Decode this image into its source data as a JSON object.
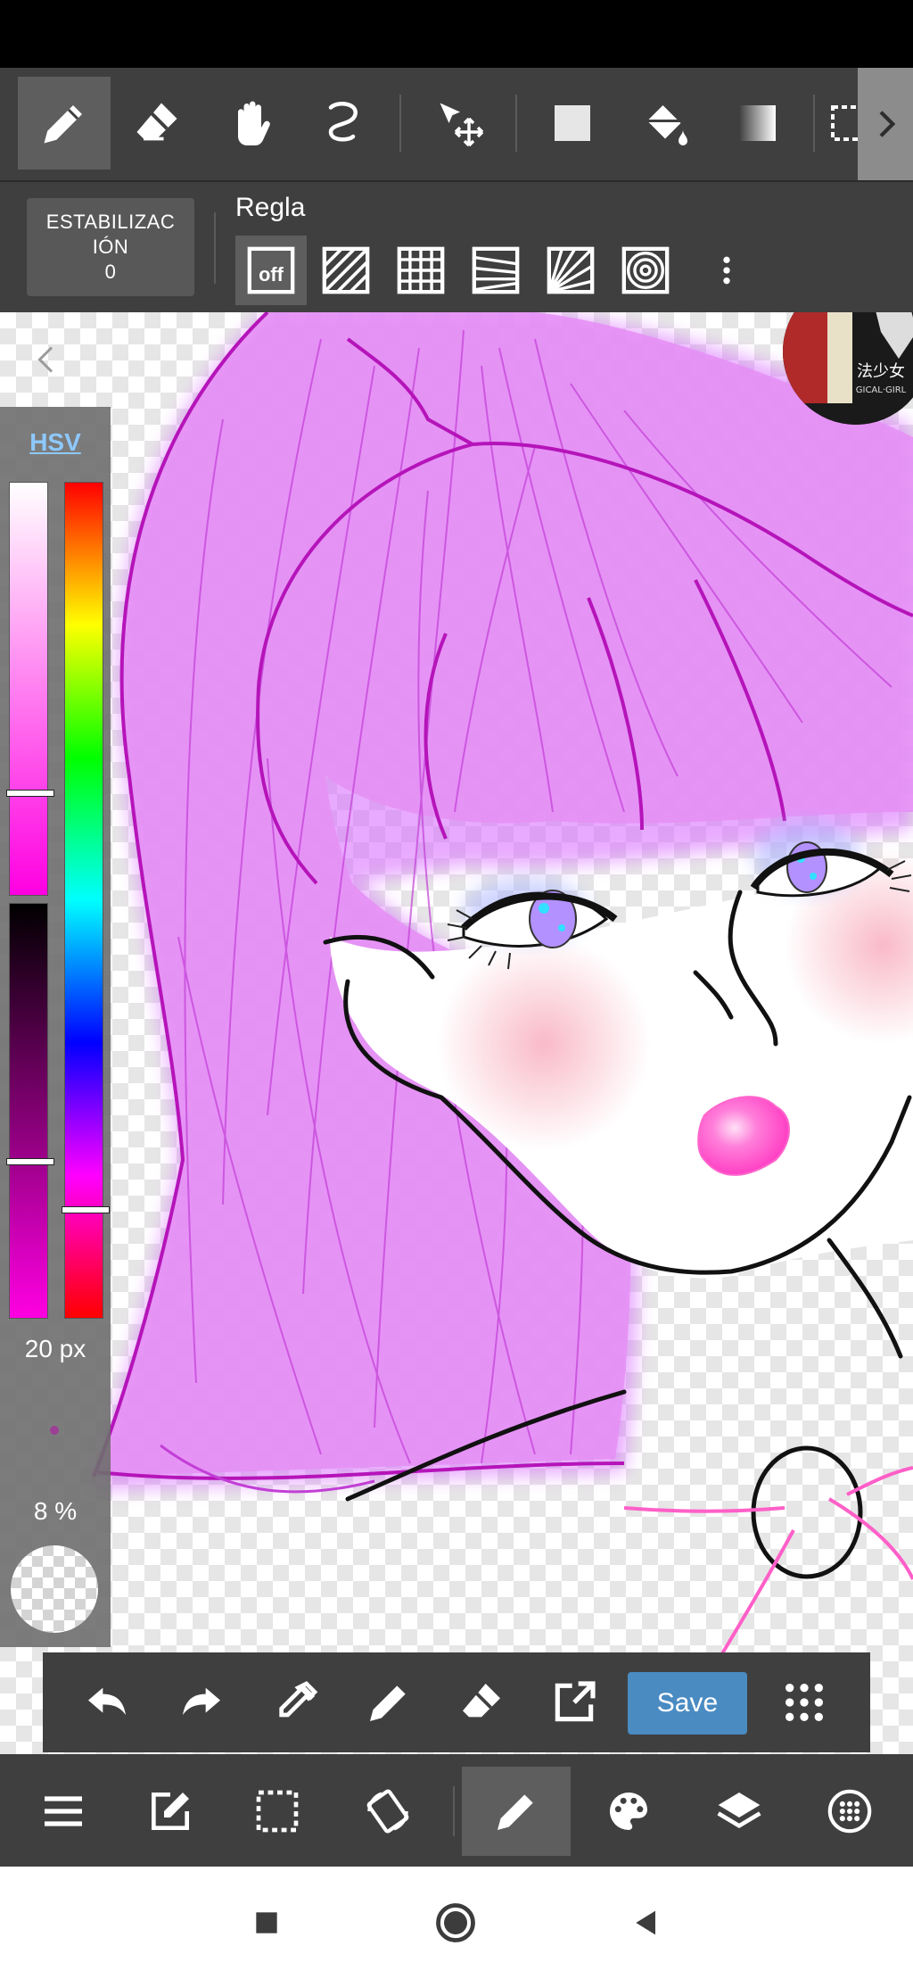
{
  "top_toolbar": {
    "tools": [
      {
        "icon": "pen-icon",
        "active": true
      },
      {
        "icon": "eraser-icon",
        "active": false
      },
      {
        "icon": "hand-icon",
        "active": false
      },
      {
        "icon": "lasso-icon",
        "active": false
      },
      {
        "icon": "move-icon",
        "active": false
      },
      {
        "icon": "fill-rect-icon",
        "active": false
      },
      {
        "icon": "bucket-icon",
        "active": false
      },
      {
        "icon": "gradient-icon",
        "active": false
      },
      {
        "icon": "select-icon",
        "active": false
      }
    ]
  },
  "sub_toolbar": {
    "stabilization_label": "ESTABILIZAC IÓN",
    "stabilization_line1": "ESTABILIZAC",
    "stabilization_line2": "IÓN",
    "stabilization_value": "0",
    "ruler_label": "Regla",
    "ruler_off_label": "off",
    "rulers": [
      "ruler-off-icon",
      "ruler-parallel-icon",
      "ruler-grid-icon",
      "ruler-perspective-icon",
      "ruler-radial-icon",
      "ruler-concentric-icon"
    ]
  },
  "color_panel": {
    "mode_tab": "HSV",
    "brush_size": "20 px",
    "opacity": "8 %",
    "colors": {
      "current": "#ff00e1",
      "line_pink": "#d21fc8",
      "hair_fill": "#e690f5",
      "outline": "#111111"
    },
    "levels": {
      "saturation": 0.75,
      "value": 0.62,
      "hue": 0.87
    }
  },
  "action_bar": {
    "save_label": "Save",
    "buttons": [
      "undo-icon",
      "redo-icon",
      "eyedropper-icon",
      "pen-icon",
      "eraser-icon",
      "export-icon",
      "save-button",
      "grid-menu-icon"
    ]
  },
  "bottom_nav": {
    "buttons": [
      "menu-icon",
      "edit-icon",
      "selection-icon",
      "rotate-icon",
      "brush-icon",
      "palette-icon",
      "layers-icon",
      "materials-icon"
    ],
    "active": "brush-icon"
  },
  "avatar": {
    "text": "法少女",
    "subtext": "GICAL·GIRL"
  },
  "theme": {
    "toolbar_bg": "#3f3f3f",
    "active_bg": "#5e5e5e",
    "save_blue": "#4a8bc2",
    "hsv_blue": "#8ec8ff"
  }
}
